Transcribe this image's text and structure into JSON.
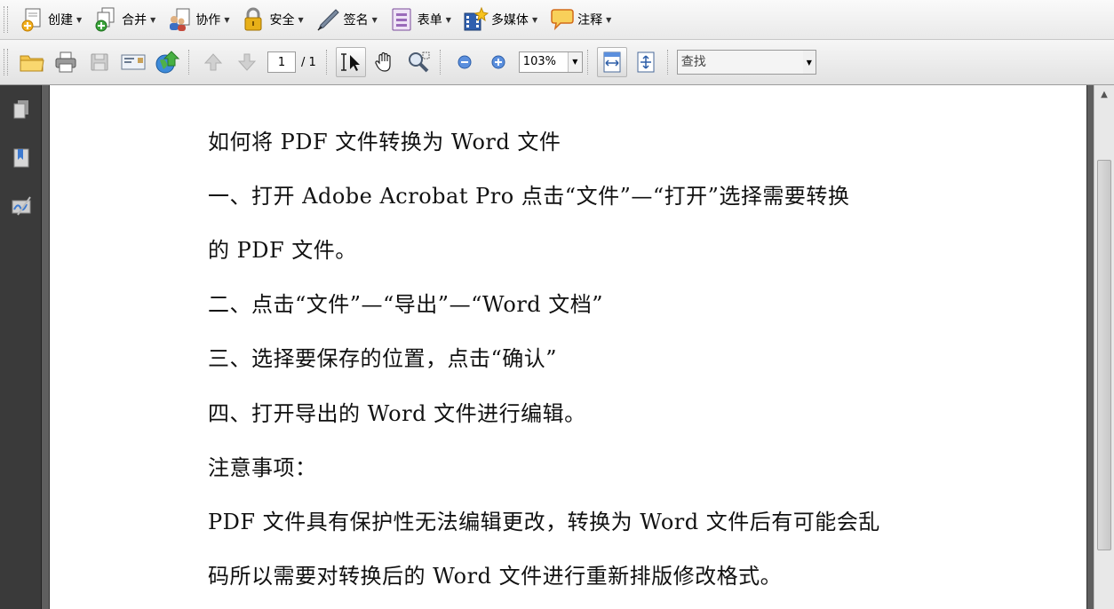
{
  "menus": [
    {
      "id": "create",
      "label": "创建",
      "icon": "create-document-icon"
    },
    {
      "id": "combine",
      "label": "合并",
      "icon": "combine-files-icon"
    },
    {
      "id": "collaborate",
      "label": "协作",
      "icon": "collaborate-icon"
    },
    {
      "id": "secure",
      "label": "安全",
      "icon": "lock-icon"
    },
    {
      "id": "sign",
      "label": "签名",
      "icon": "pen-icon"
    },
    {
      "id": "forms",
      "label": "表单",
      "icon": "form-icon"
    },
    {
      "id": "multimedia",
      "label": "多媒体",
      "icon": "film-icon"
    },
    {
      "id": "comment",
      "label": "注释",
      "icon": "speech-bubble-icon"
    }
  ],
  "toolbar": {
    "page_current": "1",
    "page_total": "/ 1",
    "zoom": "103%",
    "find_placeholder": "查找"
  },
  "document": {
    "lines": [
      "如何将 PDF 文件转换为 Word 文件",
      "一、打开 Adobe Acrobat Pro 点击“文件”—“打开”选择需要转换",
      "的 PDF 文件。",
      "二、点击“文件”—“导出”—“Word 文档”",
      "三、选择要保存的位置，点击“确认”",
      "四、打开导出的 Word 文件进行编辑。",
      "注意事项：",
      "PDF 文件具有保护性无法编辑更改，转换为 Word 文件后有可能会乱",
      "码所以需要对转换后的 Word 文件进行重新排版修改格式。"
    ]
  },
  "colors": {
    "nav_background": "#3a3a3a",
    "doc_background": "#5f5f5f",
    "page_background": "#ffffff"
  }
}
